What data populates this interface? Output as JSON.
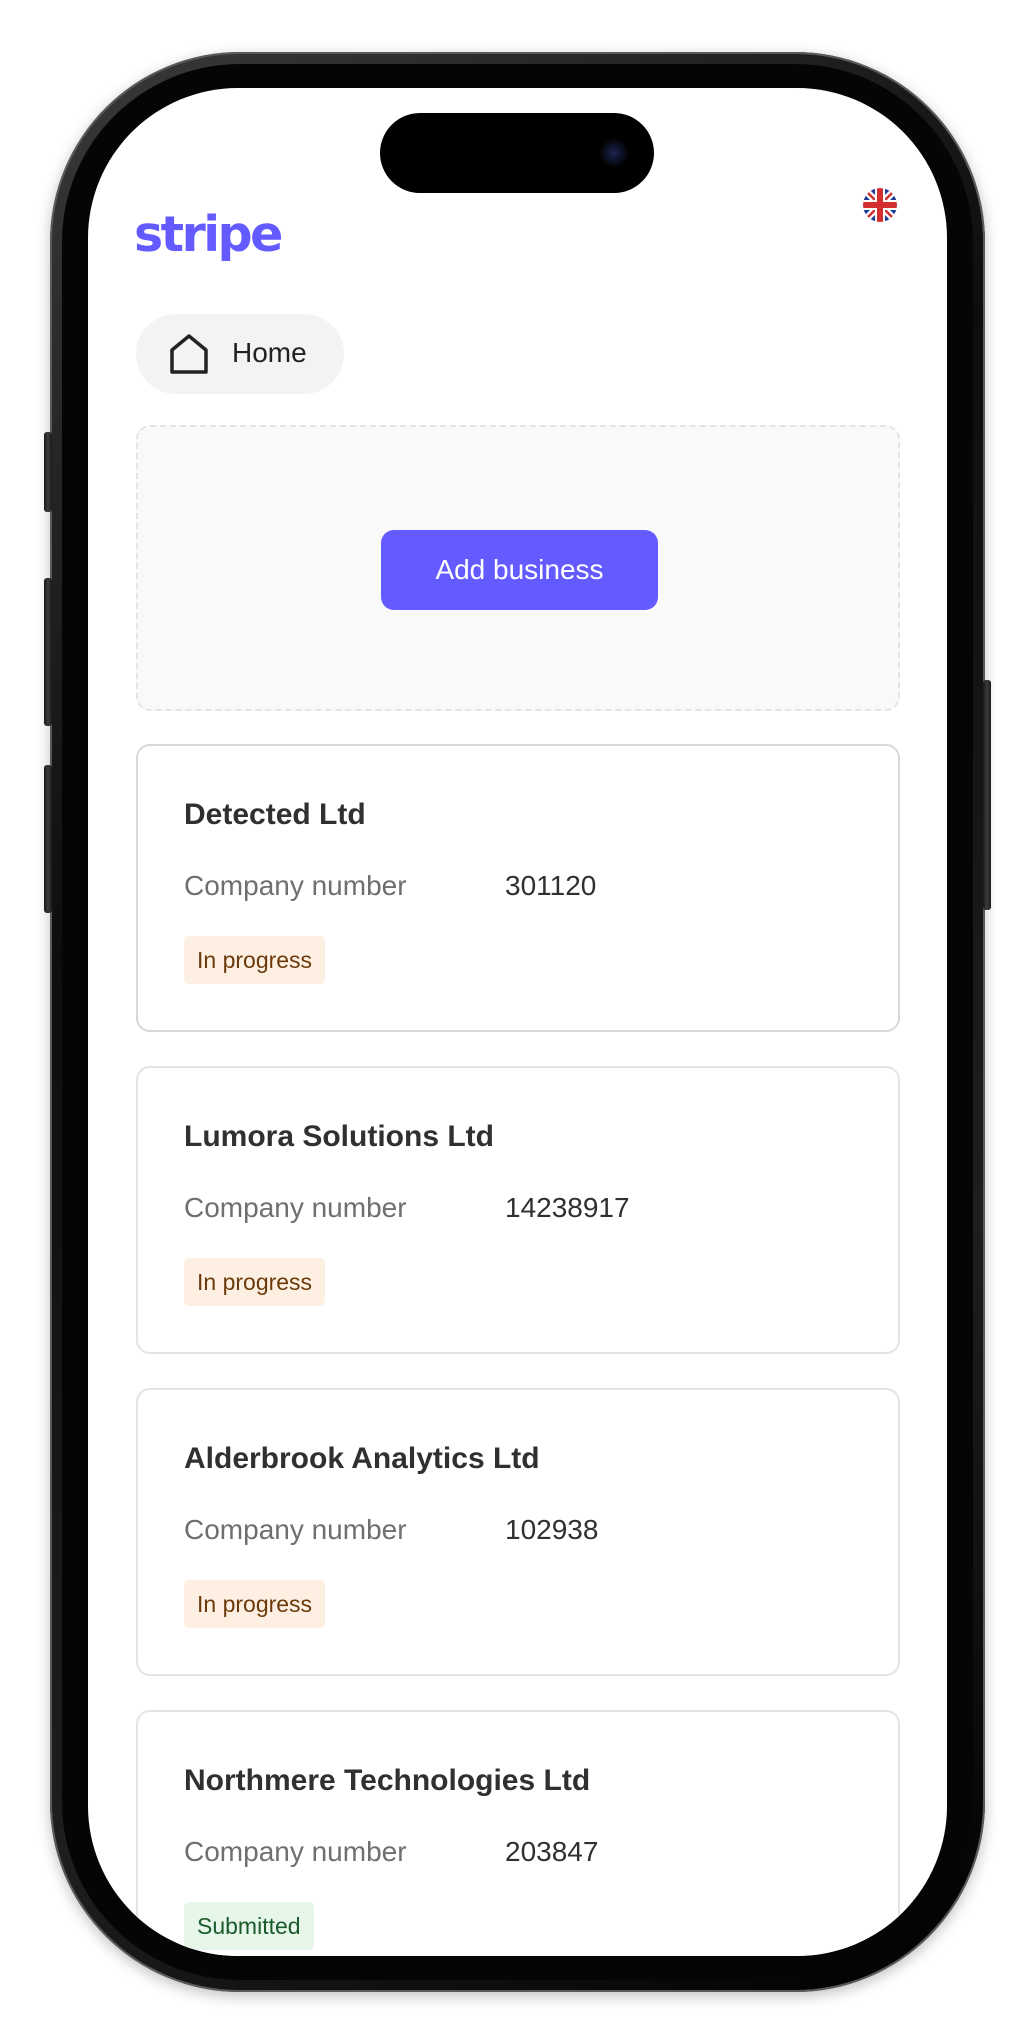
{
  "header": {
    "logo_text": "stripe",
    "language_flag": "uk-flag-icon",
    "home_label": "Home"
  },
  "add_business": {
    "button_label": "Add business"
  },
  "businesses": [
    {
      "name": "Detected Ltd",
      "number_label": "Company number",
      "number": "301120",
      "status": "In progress"
    },
    {
      "name": "Lumora Solutions Ltd",
      "number_label": "Company number",
      "number": "14238917",
      "status": "In progress"
    },
    {
      "name": "Alderbrook Analytics Ltd",
      "number_label": "Company number",
      "number": "102938",
      "status": "In progress"
    },
    {
      "name": "Northmere Technologies Ltd",
      "number_label": "Company number",
      "number": "203847",
      "status": "Submitted"
    }
  ],
  "colors": {
    "brand": "#635bff",
    "in_progress_bg": "#fdf0e2",
    "in_progress_text": "#6b3a0c",
    "submitted_bg": "#e6f7ea",
    "submitted_text": "#1b5a2b"
  }
}
